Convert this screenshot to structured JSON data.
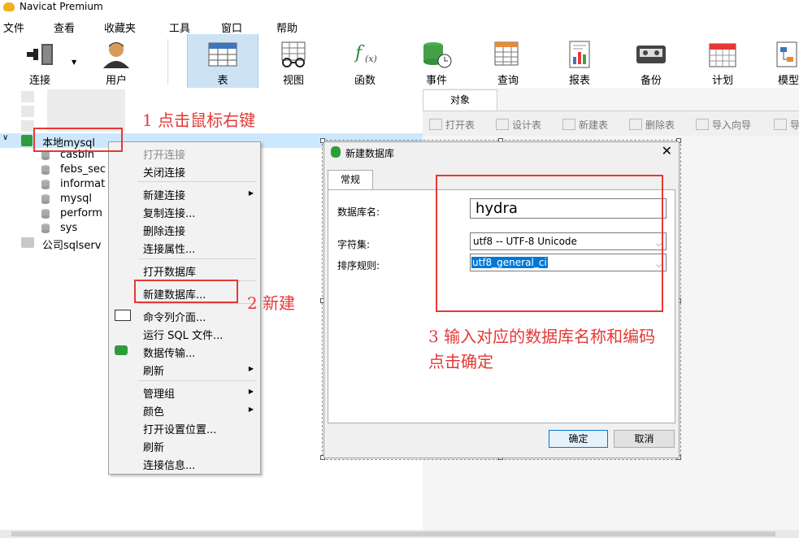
{
  "app": {
    "title": "Navicat Premium"
  },
  "menubar": [
    "文件",
    "查看",
    "收藏夹",
    "工具",
    "窗口",
    "帮助"
  ],
  "toolbar": [
    {
      "label": "连接",
      "icon": "plug-icon"
    },
    {
      "label": "用户",
      "icon": "user-icon"
    },
    {
      "label": "表",
      "icon": "table-icon"
    },
    {
      "label": "视图",
      "icon": "view-icon"
    },
    {
      "label": "函数",
      "icon": "function-icon"
    },
    {
      "label": "事件",
      "icon": "event-icon"
    },
    {
      "label": "查询",
      "icon": "query-icon"
    },
    {
      "label": "报表",
      "icon": "report-icon"
    },
    {
      "label": "备份",
      "icon": "backup-icon"
    },
    {
      "label": "计划",
      "icon": "schedule-icon"
    },
    {
      "label": "模型",
      "icon": "model-icon"
    }
  ],
  "tree": {
    "connection": "本地mysql",
    "databases": [
      "casbin",
      "febs_sec",
      "informat",
      "mysql",
      "perform",
      "sys"
    ],
    "other_connection": "公司sqlserv"
  },
  "right_panel": {
    "tab": "对象",
    "buttons": [
      "打开表",
      "设计表",
      "新建表",
      "删除表",
      "导入向导",
      "导"
    ]
  },
  "context_menu": {
    "items": [
      "打开连接",
      "关闭连接",
      "新建连接",
      "复制连接...",
      "删除连接",
      "连接属性...",
      "打开数据库",
      "新建数据库...",
      "命令列介面...",
      "运行 SQL 文件...",
      "数据传输...",
      "刷新",
      "管理组",
      "颜色",
      "打开设置位置...",
      "刷新",
      "连接信息..."
    ]
  },
  "dialog": {
    "title": "新建数据库",
    "tab": "常规",
    "fields": {
      "name_label": "数据库名:",
      "name_value": "hydra",
      "charset_label": "字符集:",
      "charset_value": "utf8 -- UTF-8 Unicode",
      "collation_label": "排序规则:",
      "collation_value": "utf8_general_ci"
    },
    "ok": "确定",
    "cancel": "取消"
  },
  "annotations": {
    "step1": "1 点击鼠标右键",
    "step2": "2 新建",
    "step3_line1": "3 输入对应的数据库名称和编码",
    "step3_line2": "点击确定"
  },
  "colors": {
    "annotation": "#e53935",
    "active_toolbar": "#cde3f5",
    "selection": "#0078d7"
  }
}
